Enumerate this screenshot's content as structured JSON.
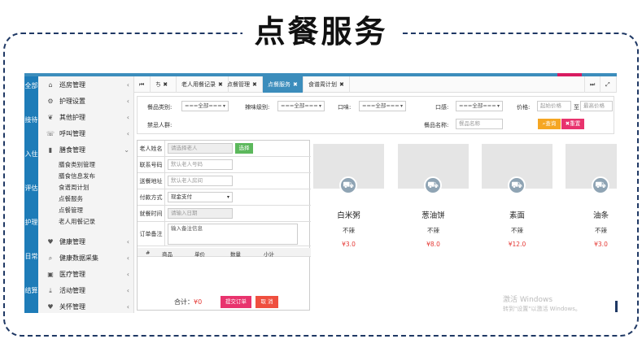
{
  "slide_title": "点餐服务",
  "leftnav": [
    "全部",
    "接待",
    "入住",
    "评估",
    "护理",
    "日常",
    "结算"
  ],
  "sidebar": {
    "items": [
      {
        "label": "巡房管理",
        "icon": "home-icon",
        "glyph": "⌂"
      },
      {
        "label": "护理设置",
        "icon": "gears-icon",
        "glyph": "⚙"
      },
      {
        "label": "其他护理",
        "icon": "leaf-icon",
        "glyph": "❦"
      },
      {
        "label": "呼叫管理",
        "icon": "phone-icon",
        "glyph": "☏"
      },
      {
        "label": "膳食管理",
        "icon": "bookmark-icon",
        "glyph": "▮"
      }
    ],
    "subitems": [
      "膳食类别管理",
      "膳食信息发布",
      "食谱周计划",
      "点餐服务",
      "点餐管理",
      "老人用餐记录"
    ],
    "items_bottom": [
      {
        "label": "健康管理",
        "icon": "heart-icon",
        "glyph": "♥"
      },
      {
        "label": "健康数据采集",
        "icon": "search-icon",
        "glyph": "⌕"
      },
      {
        "label": "医疗管理",
        "icon": "briefcase-icon",
        "glyph": "▣"
      },
      {
        "label": "活动管理",
        "icon": "download-icon",
        "glyph": "⤓"
      },
      {
        "label": "关怀管理",
        "icon": "heart-icon",
        "glyph": "♥"
      }
    ]
  },
  "tabs": {
    "nav_left": "⏮",
    "nav_mid": "ち ✖",
    "items": [
      {
        "label": "老人用餐记录"
      },
      {
        "label": "点餐管理"
      },
      {
        "label": "点餐服务",
        "active": true
      },
      {
        "label": "食谱周计划"
      }
    ],
    "nav_right": "⏭",
    "expand": "⤢"
  },
  "filter": {
    "category_label": "餐品类别:",
    "category_value": "===全部===",
    "spicy_label": "辣味级别:",
    "spicy_value": "===全部===",
    "taste_label": "口味:",
    "taste_value": "===全部===",
    "texture_label": "口感:",
    "texture_value": "===全部===",
    "price_label": "价格:",
    "price_min_placeholder": "起始价格",
    "price_to": "至",
    "price_max_placeholder": "最高价格",
    "forbidden_label": "禁忌人群:",
    "name_label": "餐品名称:",
    "name_placeholder": "餐品名称",
    "query_button": "查询",
    "reset_button": "重置"
  },
  "form": {
    "elder_label": "老人姓名",
    "elder_placeholder": "请选择老人",
    "select_button": "选择",
    "phone_label": "联系号码",
    "phone_placeholder": "默认老人号码",
    "address_label": "送餐地址",
    "address_placeholder": "默认老人房间",
    "pay_label": "付款方式",
    "pay_value": "现金支付",
    "time_label": "就餐时间",
    "time_placeholder": "请输入日期",
    "note_label": "订单备注",
    "note_placeholder": "输入备注信息",
    "cols": [
      "#",
      "商品",
      "单价",
      "数量",
      "小计"
    ],
    "total_label": "合计：",
    "total_value": "¥0",
    "submit_button": "提交订单",
    "cancel_button": "取 消"
  },
  "dishes": [
    {
      "name": "白米粥",
      "spice": "不辣",
      "price": "¥3.0"
    },
    {
      "name": "葱油饼",
      "spice": "不辣",
      "price": "¥8.0"
    },
    {
      "name": "素面",
      "spice": "不辣",
      "price": "¥12.0"
    },
    {
      "name": "油条",
      "spice": "不辣",
      "price": "¥3.0"
    }
  ],
  "watermark": {
    "line1": "激活 Windows",
    "line2": "转到\"设置\"以激活 Windows。"
  },
  "colors": {
    "accent": "#3c8dbc",
    "nav": "#1e7cb8",
    "price": "#e53935",
    "query": "#f5a623",
    "reset": "#e8336d",
    "select": "#5cb85c"
  }
}
